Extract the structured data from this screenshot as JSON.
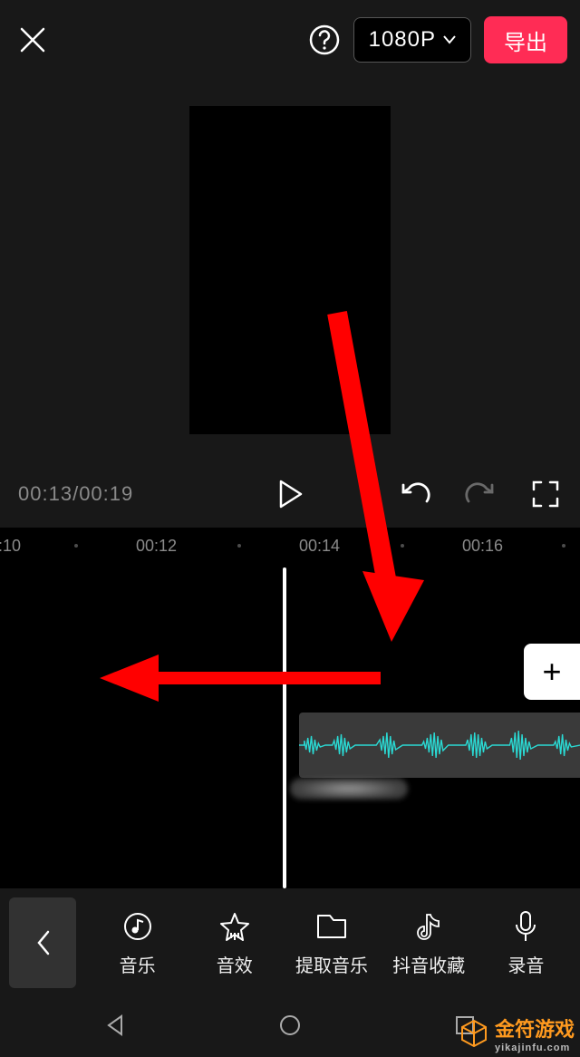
{
  "header": {
    "resolution_label": "1080P",
    "export_label": "导出"
  },
  "transport": {
    "current_time": "00:13",
    "total_time": "00:19"
  },
  "timeline": {
    "ruler_marks": [
      "0:10",
      "00:12",
      "00:14",
      "00:16"
    ],
    "add_label": "+"
  },
  "toolbar": {
    "items": [
      {
        "label": "音乐",
        "icon": "music-icon"
      },
      {
        "label": "音效",
        "icon": "sound-effect-icon"
      },
      {
        "label": "提取音乐",
        "icon": "extract-music-icon"
      },
      {
        "label": "抖音收藏",
        "icon": "douyin-favorite-icon"
      },
      {
        "label": "录音",
        "icon": "record-icon"
      }
    ]
  },
  "watermark": {
    "brand": "金符游戏",
    "domain": "yikajinfu.com"
  },
  "colors": {
    "accent": "#ff2c55",
    "waveform": "#2adad4",
    "arrow": "#ff0000",
    "watermark": "#ff9a1f"
  }
}
